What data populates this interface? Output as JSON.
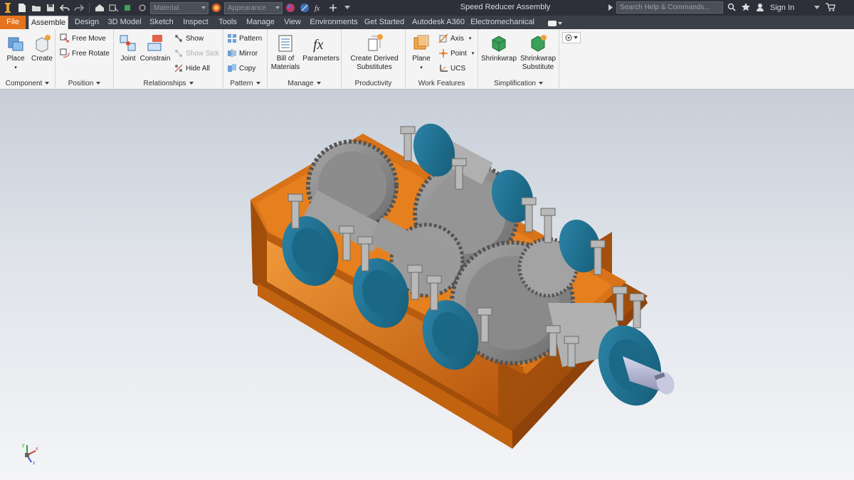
{
  "titlebar": {
    "material_combo": "Material",
    "appearance_combo": "Appearance",
    "document_title": "Speed Reducer Assembly",
    "search_placeholder": "Search Help & Commands...",
    "sign_in": "Sign In"
  },
  "tabs": [
    "File",
    "Assemble",
    "Design",
    "3D Model",
    "Sketch",
    "Inspect",
    "Tools",
    "Manage",
    "View",
    "Environments",
    "Get Started",
    "Autodesk A360",
    "Electromechanical"
  ],
  "active_tab": "Assemble",
  "ribbon": {
    "component": {
      "title": "Component",
      "place": "Place",
      "create": "Create"
    },
    "position": {
      "title": "Position",
      "free_move": "Free Move",
      "free_rotate": "Free Rotate"
    },
    "relationships": {
      "title": "Relationships",
      "joint": "Joint",
      "constrain": "Constrain",
      "show": "Show",
      "show_sick": "Show Sick",
      "hide_all": "Hide All"
    },
    "pattern": {
      "title": "Pattern",
      "pattern": "Pattern",
      "mirror": "Mirror",
      "copy": "Copy"
    },
    "manage": {
      "title": "Manage",
      "bom_line1": "Bill of",
      "bom_line2": "Materials",
      "parameters": "Parameters"
    },
    "productivity": {
      "title": "Productivity",
      "line1": "Create Derived",
      "line2": "Substitutes"
    },
    "work_features": {
      "title": "Work Features",
      "plane": "Plane",
      "axis": "Axis",
      "point": "Point",
      "ucs": "UCS"
    },
    "simplification": {
      "title": "Simplification",
      "shrinkwrap": "Shrinkwrap",
      "sub_line1": "Shrinkwrap",
      "sub_line2": "Substitute"
    }
  },
  "colors": {
    "file_tab": "#e5731e",
    "housing": "#e07c1c",
    "flange": "#1e6f8f",
    "gear": "#8c8c8c",
    "shaft": "#b8bcd8"
  },
  "triad_labels": {
    "x": "x",
    "y": "y",
    "z": "z"
  }
}
